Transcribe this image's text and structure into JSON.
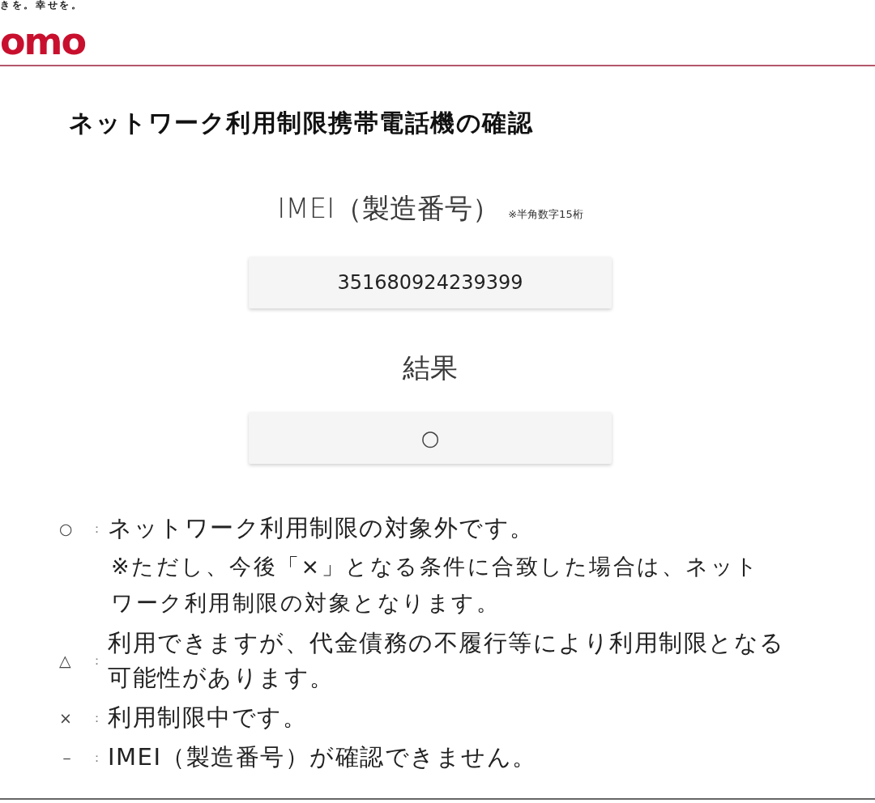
{
  "header": {
    "tagline": "きを。幸せを。",
    "logo": "omo"
  },
  "title": "ネットワーク利用制限携帯電話機の確認",
  "imei": {
    "label": "IMEI（製造番号）",
    "note": "※半角数字15桁",
    "value": "351680924239399"
  },
  "result": {
    "label": "結果",
    "value": "○"
  },
  "legend": [
    {
      "symbol": "○",
      "separator": "：",
      "text": "ネットワーク利用制限の対象外です。",
      "note": "※ただし、今後「×」となる条件に合致した場合は、ネットワーク利用制限の対象となります。"
    },
    {
      "symbol": "△",
      "separator": "：",
      "text": "利用できますが、代金債務の不履行等により利用制限となる可能性があります。"
    },
    {
      "symbol": "×",
      "separator": "：",
      "text": "利用制限中です。"
    },
    {
      "symbol": "－",
      "separator": "：",
      "text": "IMEI（製造番号）が確認できません。"
    }
  ]
}
